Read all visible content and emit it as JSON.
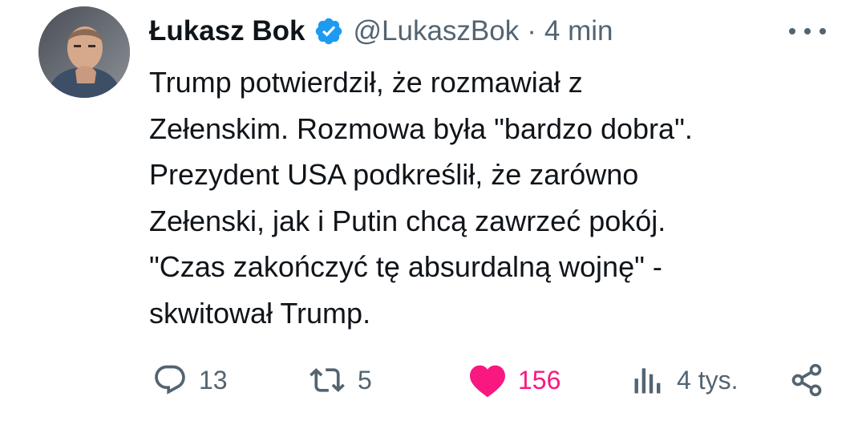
{
  "author": {
    "name": "Łukasz Bok",
    "handle": "@LukaszBok",
    "separator": "·",
    "time": "4 min",
    "avatar_icon": "avatar-photo"
  },
  "tweet": {
    "lines": [
      "Trump potwierdził, że rozmawiał z",
      "Zełenskim. Rozmowa była \"bardzo dobra\".",
      "Prezydent USA podkreślił, że zarówno",
      "Zełenski, jak i Putin chcą zawrzeć pokój.",
      "\"Czas zakończyć tę absurdalną wojnę\" -",
      "skwitował Trump."
    ]
  },
  "actions": {
    "replies": "13",
    "reposts": "5",
    "likes": "156",
    "views": "4 tys."
  },
  "colors": {
    "verified": "#1d9bf0",
    "like": "#f91880",
    "muted": "#536471",
    "text": "#0f1419"
  }
}
